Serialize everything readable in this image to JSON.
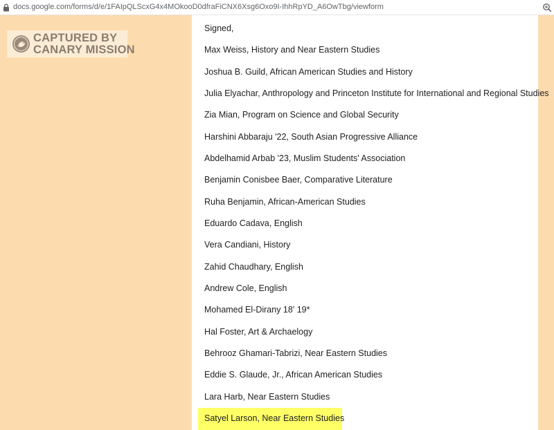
{
  "browser": {
    "url": "docs.google.com/forms/d/e/1FAIpQLScxG4x4MOkooD0dfraFiCNX6Xsg6Oxo9I-IhhRpYD_A6OwTbg/viewform",
    "icons": [
      "lock-icon",
      "zoom-icon"
    ]
  },
  "watermark": {
    "line1": "CAPTURED BY",
    "line2": "CANARY MISSION",
    "icon": "canary-bird-icon",
    "color": "#8c7c6e",
    "background": "#fbecd6"
  },
  "form": {
    "signed_label": "Signed,",
    "signatories": [
      "Max Weiss, History and Near Eastern Studies",
      "Joshua B. Guild,  African American Studies and History",
      "Julia Elyachar, Anthropology and Princeton Institute for International and Regional Studies",
      "Zia Mian, Program on Science and Global Security",
      "Harshini Abbaraju '22, South Asian Progressive Alliance",
      "Abdelhamid Arbab '23, Muslim Students' Association",
      "Benjamin Conisbee Baer, Comparative Literature",
      "Ruha Benjamin, African-American Studies",
      "Eduardo Cadava, English",
      "Vera Candiani, History",
      "Zahid Chaudhary, English",
      "Andrew Cole, English",
      "Mohamed El-Dirany 18' 19*",
      "Hal Foster, Art & Archaelogy",
      "Behrooz Ghamari-Tabrizi, Near Eastern Studies",
      "Eddie S. Glaude, Jr., African American Studies",
      "Lara Harb, Near Eastern Studies"
    ],
    "highlighted_signatory": "Satyel Larson, Near Eastern Studies"
  },
  "colors": {
    "page_background": "#fcdcae",
    "highlight": "#ffff66",
    "text": "#202124"
  }
}
